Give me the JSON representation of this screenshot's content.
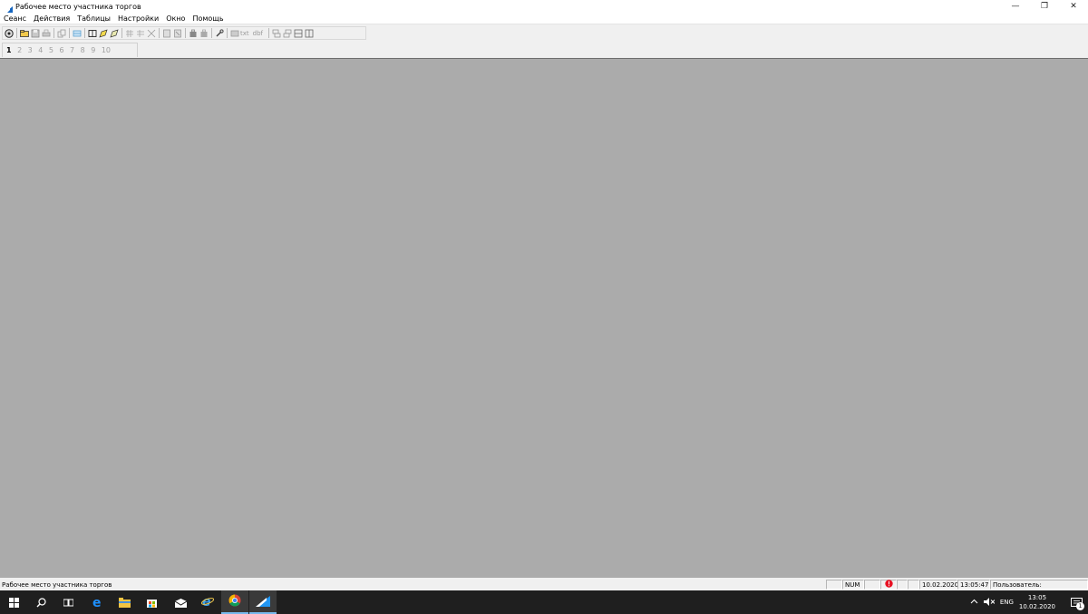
{
  "window": {
    "title": "Рабочее место участника торгов",
    "controls": {
      "minimize": "—",
      "restore": "❐",
      "close": "✕"
    }
  },
  "menu": {
    "items": [
      "Сеанс",
      "Действия",
      "Таблицы",
      "Настройки",
      "Окно",
      "Помощь"
    ]
  },
  "toolbar": {
    "txt_label": "txt",
    "dbf_label": "dbf"
  },
  "tabs": {
    "items": [
      "1",
      "2",
      "3",
      "4",
      "5",
      "6",
      "7",
      "8",
      "9",
      "10"
    ],
    "active": "1"
  },
  "statusbar": {
    "message": "Рабочее место участника торгов",
    "num": "NUM",
    "date": "10.02.2020",
    "time": "13:05:47",
    "user_label": "Пользователь:"
  },
  "taskbar": {
    "language": "ENG",
    "clock_time": "13:05",
    "clock_date": "10.02.2020",
    "notification_count": "1"
  },
  "colors": {
    "mdi_background": "#ababab",
    "taskbar": "#1f1f1f",
    "alert": "#e81123"
  }
}
